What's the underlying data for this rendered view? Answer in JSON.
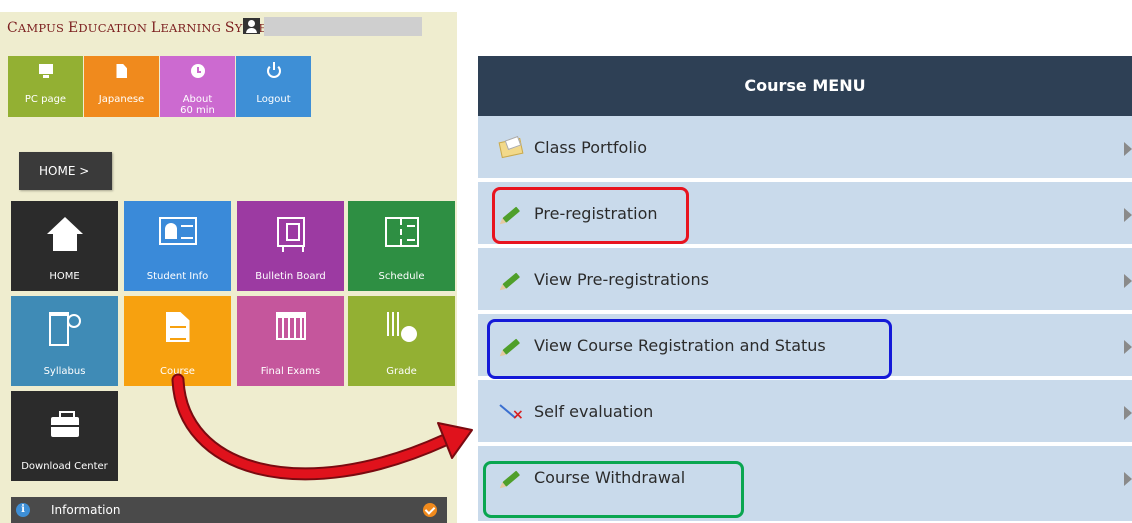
{
  "header": {
    "system_title_c": "C",
    "system_title_ampus": "AMPUS ",
    "system_title_e": "E",
    "system_title_ducation": "DUCATION ",
    "system_title_l": "L",
    "system_title_earning": "EARNING ",
    "system_title_s": "S",
    "system_title_ystem": "YSTEM",
    "user_icon": "user-icon"
  },
  "top_buttons": [
    {
      "label": "PC page",
      "icon": "monitor-icon",
      "color": "#93b033"
    },
    {
      "label": "Japanese",
      "icon": "document-icon",
      "color": "#f08a1d"
    },
    {
      "label_line1": "About",
      "label_line2": "60 min",
      "icon": "clock-icon",
      "color": "#cc6ad0"
    },
    {
      "label": "Logout",
      "icon": "power-icon",
      "color": "#3e8fd6"
    }
  ],
  "breadcrumb": {
    "label": "HOME >"
  },
  "tiles": [
    {
      "label": "HOME",
      "icon": "house-icon",
      "color": "#2b2b2b"
    },
    {
      "label": "Student Info",
      "icon": "id-card-icon",
      "color": "#3a8ad9"
    },
    {
      "label": "Bulletin Board",
      "icon": "board-icon",
      "color": "#9c3aa2"
    },
    {
      "label": "Schedule",
      "icon": "notebook-icon",
      "color": "#2e8f43"
    },
    {
      "label": "Syllabus",
      "icon": "books-icon",
      "color": "#3f8bb6"
    },
    {
      "label": "Course",
      "icon": "page-icon",
      "color": "#f7a10f"
    },
    {
      "label": "Final Exams",
      "icon": "calendar-icon",
      "color": "#c5569c"
    },
    {
      "label": "Grade",
      "icon": "chart-icon",
      "color": "#93b033"
    },
    {
      "label": "Download Center",
      "icon": "briefcase-icon",
      "color": "#2b2b2b"
    }
  ],
  "info_bar": {
    "label": "Information",
    "icon": "info-icon",
    "status_icon": "check-icon"
  },
  "course_menu": {
    "title": "Course MENU",
    "items": [
      {
        "label": "Class Portfolio",
        "icon": "folder-icon"
      },
      {
        "label": "Pre-registration",
        "icon": "pencil-icon",
        "highlight": "#e8141f"
      },
      {
        "label": "View Pre-registrations",
        "icon": "pencil-icon"
      },
      {
        "label": "View Course Registration and Status",
        "icon": "pencil-icon",
        "highlight": "#1419d8"
      },
      {
        "label": "Self evaluation",
        "icon": "evaluation-icon"
      },
      {
        "label": "Course Withdrawal",
        "icon": "pencil-icon",
        "highlight": "#0aa650"
      }
    ]
  },
  "annotation_arrow_color": "#d8141f"
}
